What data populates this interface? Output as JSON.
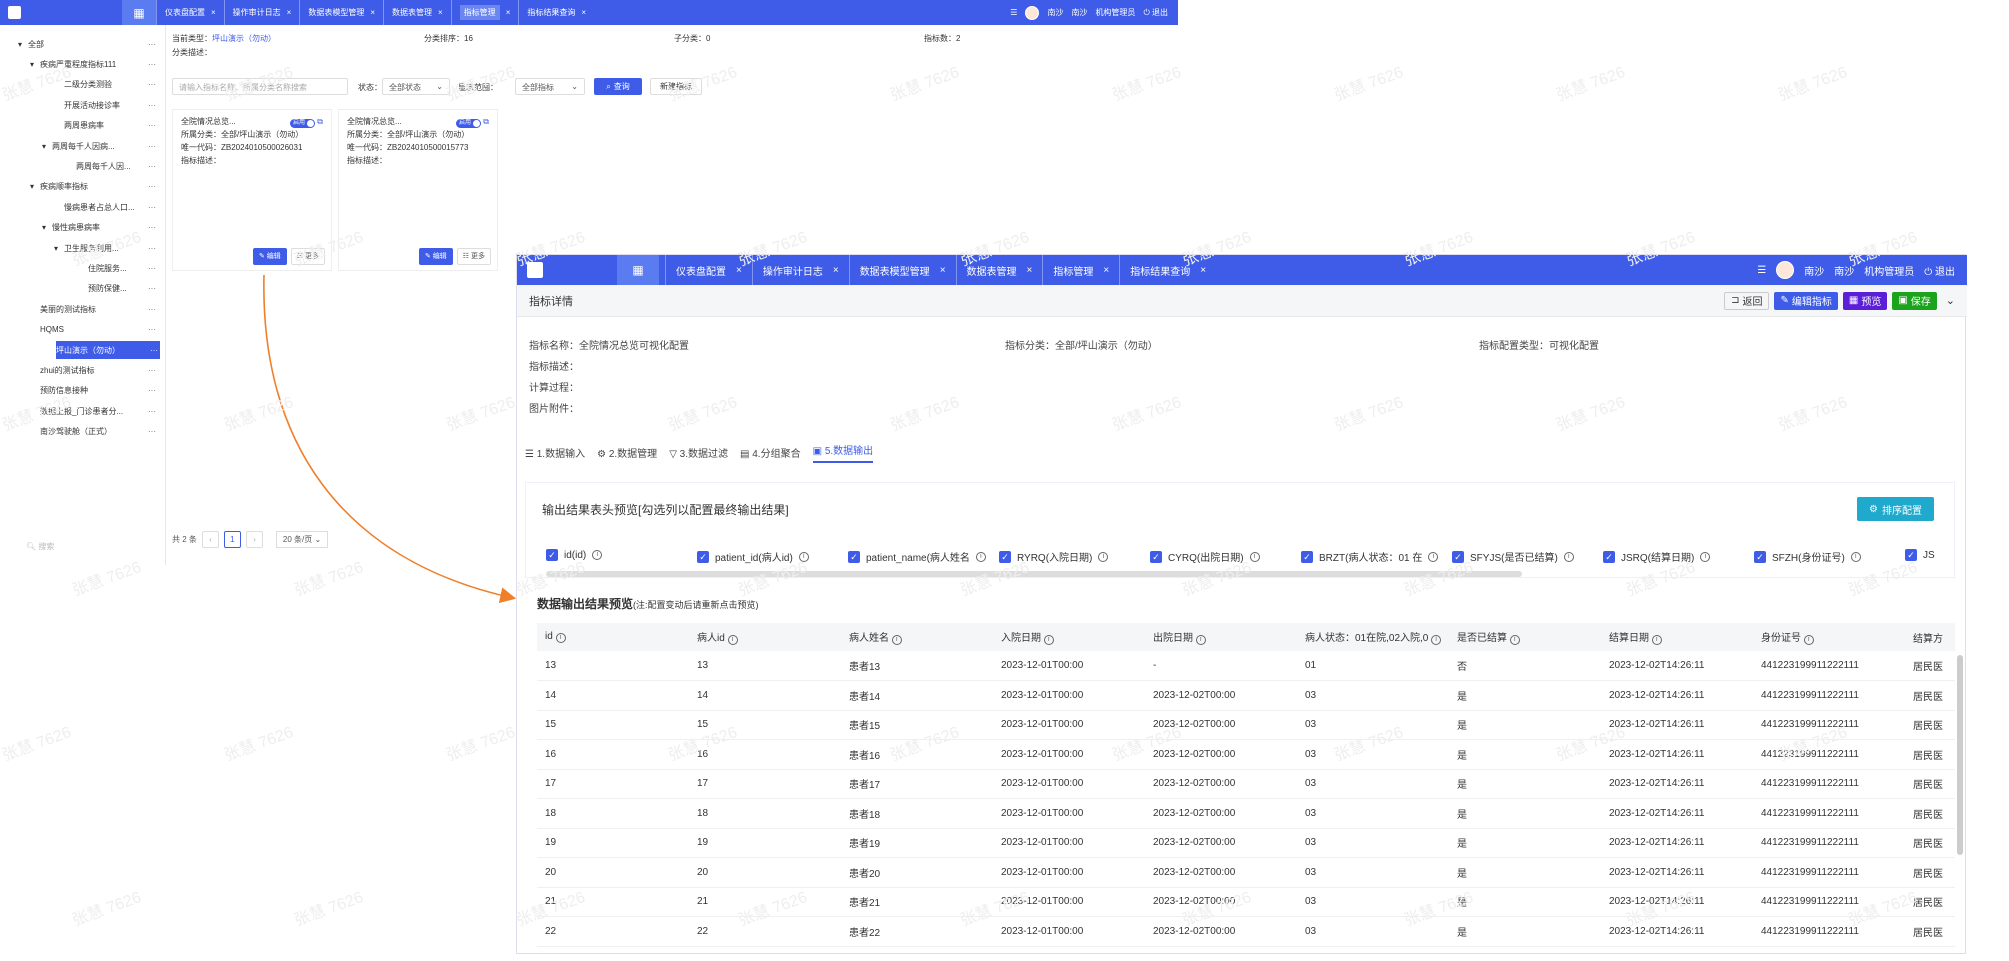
{
  "small_window": {
    "topbar": {
      "tabs": [
        "仪表盘配置",
        "操作审计日志",
        "数据表模型管理",
        "数据表管理",
        "指标管理",
        "指标结果查询"
      ],
      "active_tab": "指标管理",
      "user_name": "南沙",
      "user_org": "南沙",
      "role": "机构管理员",
      "logout": "退出"
    },
    "tree": [
      {
        "label": "全部",
        "level": 0,
        "arrow": "▾"
      },
      {
        "label": "疾病严重程度指标111",
        "level": 1,
        "arrow": "▾"
      },
      {
        "label": "二级分类测验",
        "level": 3,
        "arrow": ""
      },
      {
        "label": "开展活动接诊率",
        "level": 3,
        "arrow": ""
      },
      {
        "label": "两周患病率",
        "level": 3,
        "arrow": ""
      },
      {
        "label": "两周每千人因病...",
        "level": 2,
        "arrow": "▾"
      },
      {
        "label": "两周每千人因...",
        "level": 4,
        "arrow": ""
      },
      {
        "label": "疾病顺率指标",
        "level": 1,
        "arrow": "▾"
      },
      {
        "label": "慢病患者占总人口...",
        "level": 3,
        "arrow": ""
      },
      {
        "label": "慢性病患病率",
        "level": 2,
        "arrow": "▾"
      },
      {
        "label": "卫生服务利用...",
        "level": 3,
        "arrow": "▾"
      },
      {
        "label": "住院服务...",
        "level": 5,
        "arrow": ""
      },
      {
        "label": "预防保健...",
        "level": 5,
        "arrow": ""
      },
      {
        "label": "美丽的测试指标",
        "level": 1,
        "arrow": ""
      },
      {
        "label": "HQMS",
        "level": 1,
        "arrow": ""
      },
      {
        "label": "坪山演示（勿动）",
        "level": 1,
        "arrow": "",
        "selected": true
      },
      {
        "label": "zhui的测试指标",
        "level": 1,
        "arrow": ""
      },
      {
        "label": "预防信息接种",
        "level": 1,
        "arrow": ""
      },
      {
        "label": "数据上报_门诊患者分...",
        "level": 1,
        "arrow": ""
      },
      {
        "label": "南沙驾驶舱（正式）",
        "level": 1,
        "arrow": ""
      }
    ],
    "search_placeholder": "搜索",
    "meta": {
      "current_type_label": "当前类型：",
      "current_type_value": "坪山演示（勿动）",
      "sort_label": "分类排序：16",
      "sub_label": "子分类：0",
      "count_label": "指标数：2",
      "desc_label": "分类描述："
    },
    "filter": {
      "search_placeholder": "请输入指标名称、所属分类名称搜索",
      "status_label": "状态：",
      "status_value": "全部状态",
      "range_label": "显示范围：",
      "range_value": "全部指标",
      "query_btn": "查询",
      "add_btn": "新建指标"
    },
    "cards": [
      {
        "title": "全院情况总览...",
        "toggle": "启用",
        "category": "所属分类：全部/坪山演示（勿动）",
        "code": "唯一代码：ZB2024010500026031",
        "desc": "指标描述：",
        "edit": "编辑",
        "more": "更多"
      },
      {
        "title": "全院情况总览...",
        "toggle": "启用",
        "category": "所属分类：全部/坪山演示（勿动）",
        "code": "唯一代码：ZB2024010500015773",
        "desc": "指标描述：",
        "edit": "编辑",
        "more": "更多"
      }
    ],
    "pager": {
      "total": "共 2 条",
      "page": "1",
      "size": "20 条/页"
    }
  },
  "big_window": {
    "topbar": {
      "tabs": [
        "仪表盘配置",
        "操作审计日志",
        "数据表模型管理",
        "数据表管理",
        "指标管理",
        "指标结果查询"
      ],
      "user_name": "南沙",
      "user_org": "南沙",
      "role": "机构管理员",
      "logout": "退出"
    },
    "header": {
      "title": "指标详情",
      "back": "返回",
      "edit": "编辑指标",
      "preview": "预览",
      "save": "保存"
    },
    "info": {
      "name": "指标名称：全院情况总览可视化配置",
      "category": "指标分类：全部/坪山演示（勿动）",
      "config_type": "指标配置类型：可视化配置",
      "desc": "指标描述：",
      "process": "计算过程：",
      "attach": "图片附件："
    },
    "steps": [
      "1.数据输入",
      "2.数据管理",
      "3.数据过滤",
      "4.分组聚合",
      "5.数据输出"
    ],
    "output_panel": {
      "title": "输出结果表头预览[勾选列以配置最终输出结果]",
      "sort_btn": "排序配置",
      "columns": [
        "id(id)",
        "patient_id(病人id)",
        "patient_name(病人姓名",
        "RYRQ(入院日期)",
        "CYRQ(出院日期)",
        "BRZT(病人状态：01 在",
        "SFYJS(是否已结算)",
        "JSRQ(结算日期)",
        "SFZH(身份证号)",
        "JS"
      ]
    },
    "preview": {
      "title": "数据输出结果预览",
      "note": "(注:配置变动后请重新点击预览)",
      "headers": [
        "id",
        "病人id",
        "病人姓名",
        "入院日期",
        "出院日期",
        "病人状态：01在院,02入院,0",
        "是否已结算",
        "结算日期",
        "身份证号",
        "结算方"
      ],
      "rows": [
        [
          "13",
          "13",
          "患者13",
          "2023-12-01T00:00",
          "-",
          "01",
          "否",
          "2023-12-02T14:26:11",
          "441223199911222111",
          "居民医"
        ],
        [
          "14",
          "14",
          "患者14",
          "2023-12-01T00:00",
          "2023-12-02T00:00",
          "03",
          "是",
          "2023-12-02T14:26:11",
          "441223199911222111",
          "居民医"
        ],
        [
          "15",
          "15",
          "患者15",
          "2023-12-01T00:00",
          "2023-12-02T00:00",
          "03",
          "是",
          "2023-12-02T14:26:11",
          "441223199911222111",
          "居民医"
        ],
        [
          "16",
          "16",
          "患者16",
          "2023-12-01T00:00",
          "2023-12-02T00:00",
          "03",
          "是",
          "2023-12-02T14:26:11",
          "441223199911222111",
          "居民医"
        ],
        [
          "17",
          "17",
          "患者17",
          "2023-12-01T00:00",
          "2023-12-02T00:00",
          "03",
          "是",
          "2023-12-02T14:26:11",
          "441223199911222111",
          "居民医"
        ],
        [
          "18",
          "18",
          "患者18",
          "2023-12-01T00:00",
          "2023-12-02T00:00",
          "03",
          "是",
          "2023-12-02T14:26:11",
          "441223199911222111",
          "居民医"
        ],
        [
          "19",
          "19",
          "患者19",
          "2023-12-01T00:00",
          "2023-12-02T00:00",
          "03",
          "是",
          "2023-12-02T14:26:11",
          "441223199911222111",
          "居民医"
        ],
        [
          "20",
          "20",
          "患者20",
          "2023-12-01T00:00",
          "2023-12-02T00:00",
          "03",
          "是",
          "2023-12-02T14:26:11",
          "441223199911222111",
          "居民医"
        ],
        [
          "21",
          "21",
          "患者21",
          "2023-12-01T00:00",
          "2023-12-02T00:00",
          "03",
          "是",
          "2023-12-02T14:26:11",
          "441223199911222111",
          "居民医"
        ],
        [
          "22",
          "22",
          "患者22",
          "2023-12-01T00:00",
          "2023-12-02T00:00",
          "03",
          "是",
          "2023-12-02T14:26:11",
          "441223199911222111",
          "居民医"
        ]
      ]
    }
  },
  "watermark": "张慧 7626",
  "colors": {
    "primary": "#3e5ce8",
    "arrow": "#f07f2a",
    "teal": "#1fa9cc",
    "purple": "#5a1fd6",
    "green": "#1ca31c"
  }
}
